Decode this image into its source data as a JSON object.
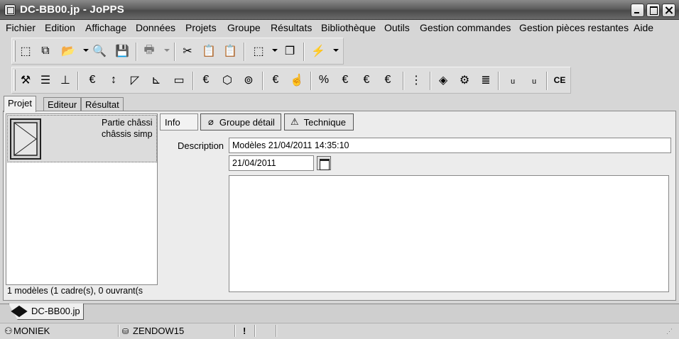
{
  "window": {
    "title": "DC-BB00.jp - JoPPS"
  },
  "menu": [
    "Fichier",
    "Edition",
    "Affichage",
    "Données",
    "Projets",
    "Groupe",
    "Résultats",
    "Bibliothèque",
    "Outils",
    "Gestion commandes",
    "Gestion pièces restantes",
    "Aide"
  ],
  "toolbar1": [
    {
      "icon": "new-icon",
      "glyph": "⬚"
    },
    {
      "icon": "copy-icon",
      "glyph": "⧉"
    },
    {
      "icon": "open-folder-icon",
      "glyph": "📂"
    },
    {
      "icon": "search-document-icon",
      "glyph": "🔍"
    },
    {
      "icon": "save-icon",
      "glyph": "💾"
    },
    {
      "icon": "print-icon",
      "glyph": "🖶"
    },
    {
      "icon": "cut-icon",
      "glyph": "✂"
    },
    {
      "icon": "paste-icon",
      "glyph": "📋"
    },
    {
      "icon": "paste-special-icon",
      "glyph": "📋"
    },
    {
      "icon": "select-area-icon",
      "glyph": "⬚"
    },
    {
      "icon": "windows-icon",
      "glyph": "❐"
    },
    {
      "icon": "lightning-icon",
      "glyph": "⚡"
    }
  ],
  "toolbar2": [
    {
      "icon": "tools-icon",
      "glyph": "⚒"
    },
    {
      "icon": "profile-stack-icon",
      "glyph": "☰"
    },
    {
      "icon": "profile-icon",
      "glyph": "⊥"
    },
    {
      "icon": "price-profile-icon",
      "glyph": "€"
    },
    {
      "icon": "dimension-icon",
      "glyph": "↕"
    },
    {
      "icon": "cut-angle-icon",
      "glyph": "◸"
    },
    {
      "icon": "measure-icon",
      "glyph": "⊾"
    },
    {
      "icon": "bar-icon",
      "glyph": "▭"
    },
    {
      "icon": "price-glass-icon",
      "glyph": "€"
    },
    {
      "icon": "box-icon",
      "glyph": "⬡"
    },
    {
      "icon": "cylinders-icon",
      "glyph": "⊚"
    },
    {
      "icon": "price-frame-icon",
      "glyph": "€"
    },
    {
      "icon": "hand-frame-icon",
      "glyph": "☝"
    },
    {
      "icon": "price-percent-icon",
      "glyph": "%"
    },
    {
      "icon": "price-chart-icon",
      "glyph": "€"
    },
    {
      "icon": "price-bars-icon",
      "glyph": "€"
    },
    {
      "icon": "price-table-icon",
      "glyph": "€"
    },
    {
      "icon": "list-icon",
      "glyph": "⋮"
    },
    {
      "icon": "hinge-icon",
      "glyph": "◈"
    },
    {
      "icon": "gear-icon",
      "glyph": "⚙"
    },
    {
      "icon": "stack-icon",
      "glyph": "≣"
    },
    {
      "icon": "u-profile-icon",
      "glyph": "ᵤ"
    },
    {
      "icon": "u-frame-icon",
      "glyph": "ᵤ"
    },
    {
      "icon": "ce-mark-icon",
      "glyph": "CE"
    }
  ],
  "left_tabs": [
    "Projet",
    "Editeur",
    "Résultat"
  ],
  "project": {
    "item_line1": "Partie châssi",
    "item_line2": "châssis simp",
    "status": "1 modèles (1 cadre(s), 0 ouvrant(s"
  },
  "detail_tabs": {
    "info": "Info",
    "groupe": "Groupe détail",
    "technique": "Technique"
  },
  "form": {
    "description_label": "Description",
    "description_value": "Modèles 21/04/2011 14:35:10",
    "date_value": "21/04/2011"
  },
  "document_tab": "DC-BB00.jp",
  "statusbar": {
    "user": "MONIEK",
    "machine": "ZENDOW15",
    "alert": "!"
  }
}
